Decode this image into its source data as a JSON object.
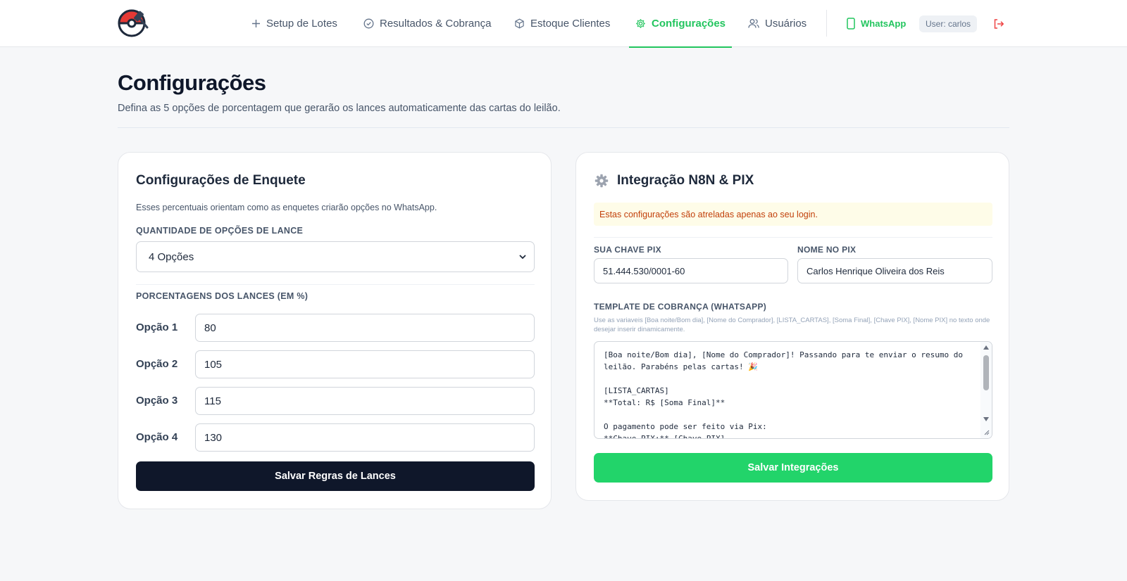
{
  "nav": {
    "items": [
      {
        "label": "Setup de Lotes",
        "icon": "plus-icon"
      },
      {
        "label": "Resultados & Cobrança",
        "icon": "check-circle-icon"
      },
      {
        "label": "Estoque Clientes",
        "icon": "box-icon"
      },
      {
        "label": "Configurações",
        "icon": "gear-icon",
        "active": true
      },
      {
        "label": "Usuários",
        "icon": "users-icon"
      }
    ],
    "whatsapp_label": "WhatsApp",
    "user_badge": "User: carlos",
    "accent_color": "#22c55e"
  },
  "page": {
    "title": "Configurações",
    "subtitle": "Defina as 5 opções de porcentagem que gerarão os lances automaticamente das cartas do leilão."
  },
  "poll": {
    "title": "Configurações de Enquete",
    "description": "Esses percentuais orientam como as enquetes criarão opções no WhatsApp.",
    "quantity_label": "QUANTIDADE DE OPÇÕES DE LANCE",
    "quantity_value": "4 Opções",
    "percent_label": "PORCENTAGENS DOS LANCES (EM %)",
    "options": [
      {
        "label": "Opção 1",
        "value": "80"
      },
      {
        "label": "Opção 2",
        "value": "105"
      },
      {
        "label": "Opção 3",
        "value": "115"
      },
      {
        "label": "Opção 4",
        "value": "130"
      }
    ],
    "save_label": "Salvar Regras de Lances"
  },
  "integration": {
    "title": "Integração N8N & PIX",
    "notice": "Estas configurações são atreladas apenas ao seu login.",
    "pix_key_label": "SUA CHAVE PIX",
    "pix_key_value": "51.444.530/0001-60",
    "pix_name_label": "NOME NO PIX",
    "pix_name_value": "Carlos Henrique Oliveira dos Reis",
    "template_label": "TEMPLATE DE COBRANÇA (WHATSAPP)",
    "template_hint": "Use as variaveis [Boa noite/Bom dia], [Nome do Comprador], [LISTA_CARTAS], [Soma Final], [Chave PIX], [Nome PIX] no texto onde desejar inserir dinamicamente.",
    "template_value": "[Boa noite/Bom dia], [Nome do Comprador]! Passando para te enviar o resumo do leilão. Parabéns pelas cartas! 🎉\n\n[LISTA_CARTAS]\n**Total: R$ [Soma Final]**\n\nO pagamento pode ser feito via Pix:\n**Chave PIX:** [Chave PIX]",
    "save_label": "Salvar Integrações"
  }
}
